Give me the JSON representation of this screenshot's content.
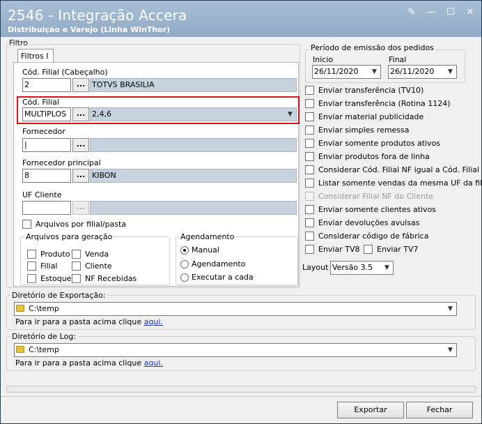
{
  "window": {
    "title": "2546 - Integração Accera",
    "subtitle": "Distribuição e Varejo (Linha WinThor)"
  },
  "filtro": {
    "label": "Filtro",
    "tab": "Filtros I",
    "cod_filial_cab": {
      "label": "Cód. Filial (Cabeçalho)",
      "value": "2",
      "desc": "TOTVS BRASILIA"
    },
    "cod_filial": {
      "label": "Cód. Filial",
      "value": "MULTIPLOS",
      "desc": "2,4,6"
    },
    "fornecedor": {
      "label": "Fornecedor",
      "value": "|",
      "desc": ""
    },
    "fornecedor_principal": {
      "label": "Fornecedor principal",
      "value": "8",
      "desc": "KIBON"
    },
    "uf_cliente": {
      "label": "UF Cliente",
      "value": "",
      "desc": ""
    },
    "dots": "...",
    "arquivos_por_filial": "Arquivos por filial/pasta",
    "arquivos_geracao": {
      "label": "Arquivos para geração",
      "items": [
        "Produto",
        "Venda",
        "Filial",
        "Cliente",
        "Estoque",
        "NF Recebidas"
      ]
    },
    "agendamento": {
      "label": "Agendamento",
      "options": [
        "Manual",
        "Agendamento",
        "Executar a cada"
      ]
    }
  },
  "periodo": {
    "label": "Período de emissão dos pedidos",
    "inicio_label": "Inicio",
    "inicio": "26/11/2020",
    "final_label": "Final",
    "final": "26/11/2020"
  },
  "options": [
    "Enviar transferência (TV10)",
    "Enviar transferência (Rotina 1124)",
    "Enviar material publicidade",
    "Enviar simples remessa",
    "Enviar somente produtos ativos",
    "Enviar produtos fora de linha",
    "Considerar Cód. Filial NF igual a Cód. Filial",
    "Listar somente vendas da mesma UF da filial",
    "Considerar Filial NF do Cliente",
    "Enviar somente clientes ativos",
    "Enviar devoluções avulsas",
    "Considerar código de fábrica"
  ],
  "tv8": "Enviar TV8",
  "tv7": "Enviar TV7",
  "layout": {
    "label": "Layout",
    "value": "Versão 3.5"
  },
  "export_dir": {
    "label": "Diretório de Exportação:",
    "path": "C:\\temp",
    "hint": "Para ir para a pasta acima clique ",
    "link": "aqui."
  },
  "log_dir": {
    "label": "Diretório de Log:",
    "path": "C:\\temp",
    "hint": "Para ir para a pasta acima clique ",
    "link": "aqui."
  },
  "buttons": {
    "exportar": "Exportar",
    "fechar": "Fechar"
  },
  "titlebar_icons": [
    "✎",
    "—",
    "☐",
    "✕"
  ],
  "arrow": "▼",
  "colors": {
    "highlight": "#d9121b",
    "title_bg": "#9fb7d0",
    "readonly_field": "#c6d3df"
  }
}
